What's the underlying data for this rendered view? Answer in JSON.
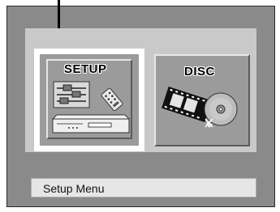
{
  "menu": {
    "tiles": [
      {
        "label": "SETUP",
        "selected": true
      },
      {
        "label": "DISC",
        "selected": false
      }
    ]
  },
  "status_bar": {
    "text": "Setup Menu"
  },
  "icons": [
    "equalizer-sliders-icon",
    "remote-control-icon",
    "dvd-player-icon",
    "film-strip-icon",
    "disc-icon"
  ]
}
